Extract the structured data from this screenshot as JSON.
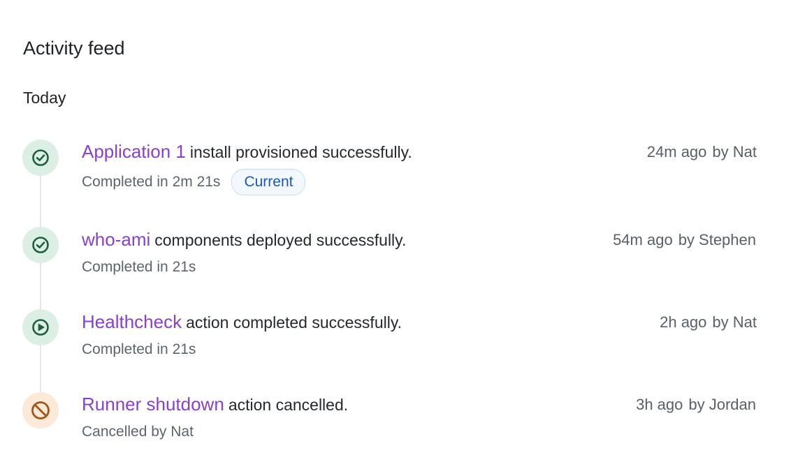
{
  "page": {
    "title": "Activity feed",
    "group_label": "Today"
  },
  "colors": {
    "subject_link": "#8a3fd1",
    "success_icon": "#1f5f3e",
    "success_bg": "#dcefe4",
    "cancel_icon": "#a35618",
    "cancel_bg": "#fde9d8",
    "pill_text": "#1d57b9"
  },
  "items": [
    {
      "icon": "check-circle-icon",
      "subject": "Application 1",
      "message": "install provisioned successfully.",
      "time": "24m ago",
      "by": "by  Nat",
      "detail": "Completed in 2m 21s",
      "pill": "Current"
    },
    {
      "icon": "check-circle-icon",
      "subject": "who-ami",
      "message": "components deployed successfully.",
      "time": "54m ago",
      "by": "by  Stephen",
      "detail": "Completed in 21s"
    },
    {
      "icon": "play-circle-icon",
      "subject": "Healthcheck",
      "message": "action completed successfully.",
      "time": "2h ago",
      "by": "by  Nat",
      "detail": "Completed in 21s"
    },
    {
      "icon": "prohibited-icon",
      "subject": "Runner shutdown",
      "message": "action cancelled.",
      "time": "3h ago",
      "by": "by  Jordan",
      "detail": "Cancelled by Nat"
    }
  ]
}
